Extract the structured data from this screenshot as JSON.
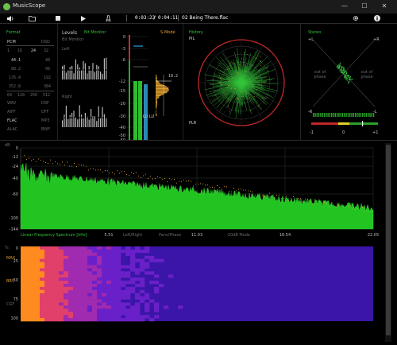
{
  "window": {
    "title": "MusicScope",
    "minimize": "—",
    "maximize": "☐",
    "close": "✕"
  },
  "toolbar": {
    "volume_icon": "speaker-icon",
    "open_icon": "folder-icon",
    "stop_icon": "stop-icon",
    "play_icon": "play-icon",
    "tune_icon": "metronome-icon",
    "elapsed": "0:03:23",
    "separator": "/",
    "total": "0:04:11",
    "track": "02 Being There.flac",
    "settings_icon": "gear-icon",
    "info_icon": "info-icon"
  },
  "format_panel": {
    "title": "Format",
    "pcm": "PCM",
    "dsd": "DSD",
    "bits": [
      "1",
      "16",
      "24",
      "32"
    ],
    "rates_left": [
      "44.1",
      "88.2",
      "176.4",
      "352.8"
    ],
    "rates_right": [
      "48",
      "96",
      "192",
      "384"
    ],
    "dsd_rates": [
      "64",
      "128",
      "256",
      "512"
    ],
    "formats_left": [
      "WAV",
      "AIFF",
      "FLAC",
      "ALAC"
    ],
    "formats_right": [
      "DSF",
      "DFF",
      "MP3",
      "BWF"
    ]
  },
  "levels_panel": {
    "title": "Levels",
    "bit_monitor": "Bit Monitor",
    "left": "Left",
    "right": "Right",
    "s_mode": "S-Mode",
    "db_scale": [
      "0",
      "-3",
      "-6",
      "-12",
      "-15",
      "-20",
      "-30",
      "-40",
      "-50",
      "-60"
    ],
    "channel_labels": [
      "LU",
      "LU"
    ],
    "peak_value": "10.2"
  },
  "history_panel": {
    "title": "History",
    "pil": "PIL",
    "plr": "PLR"
  },
  "stereo_panel": {
    "title": "Stereo",
    "plus_l": "+L",
    "plus_r": "+R",
    "minus_r": "-R",
    "minus_l": "-L",
    "out_phase_left": "out of phase",
    "out_phase_right": "out of phase",
    "corr_minus": "-1",
    "corr_zero": "0",
    "corr_plus": "+1"
  },
  "spectrum": {
    "unit": "dB",
    "y_ticks": [
      "0",
      "-12",
      "-24",
      "-40",
      "-60",
      "-100",
      "-144"
    ],
    "x_ticks": [
      "5.51",
      "11.03",
      "16.54",
      "22.05"
    ],
    "mode_label": "Linear Frequency Spectrum [kHz]",
    "mode_opts": [
      "Left/Right",
      "Pans/Phase",
      "-20dB Mode"
    ]
  },
  "spectrogram": {
    "unit": "%",
    "y_ticks": [
      "0",
      "25",
      "50",
      "75",
      "100"
    ],
    "side_labels": [
      "MAX",
      "BRY",
      "CGF"
    ]
  },
  "colors": {
    "accent_green": "#33c23a",
    "accent_orange": "#e0a030",
    "spectrum_fill": "#22c422",
    "grid": "#2d3a2d"
  }
}
